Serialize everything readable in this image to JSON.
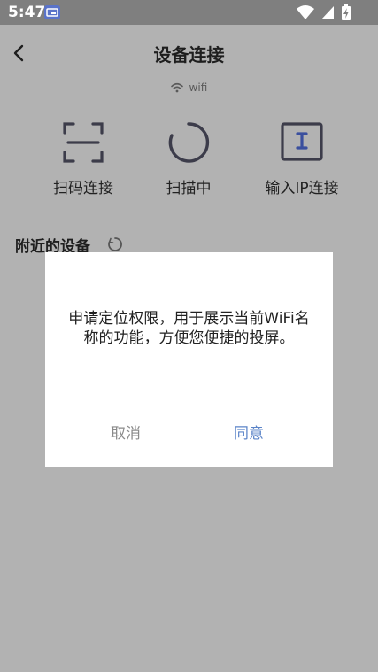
{
  "status_bar": {
    "time": "5:47",
    "badge_icon": "cast-icon",
    "right_icons": [
      "wifi-icon",
      "signal-icon",
      "battery-charging-icon"
    ]
  },
  "header": {
    "back_icon": "chevron-left-icon",
    "title": "设备连接"
  },
  "network": {
    "icon": "wifi-icon",
    "label": "wifi"
  },
  "actions": [
    {
      "icon": "scan-frame-icon",
      "label": "扫码连接"
    },
    {
      "icon": "spinner-icon",
      "label": "扫描中"
    },
    {
      "icon": "ip-input-icon",
      "label": "输入IP连接"
    }
  ],
  "nearby": {
    "label": "附近的设备",
    "icon": "loading-icon"
  },
  "dialog": {
    "message": "申请定位权限，用于展示当前WiFi名称的功能，方便您便捷的投屏。",
    "cancel_label": "取消",
    "agree_label": "同意"
  },
  "colors": {
    "overlay": "#b2b2b2",
    "status_bar": "#7f7f7f",
    "icon_dark": "#3c3c4a",
    "accent": "#5b84c8",
    "badge": "#5a73c9"
  }
}
